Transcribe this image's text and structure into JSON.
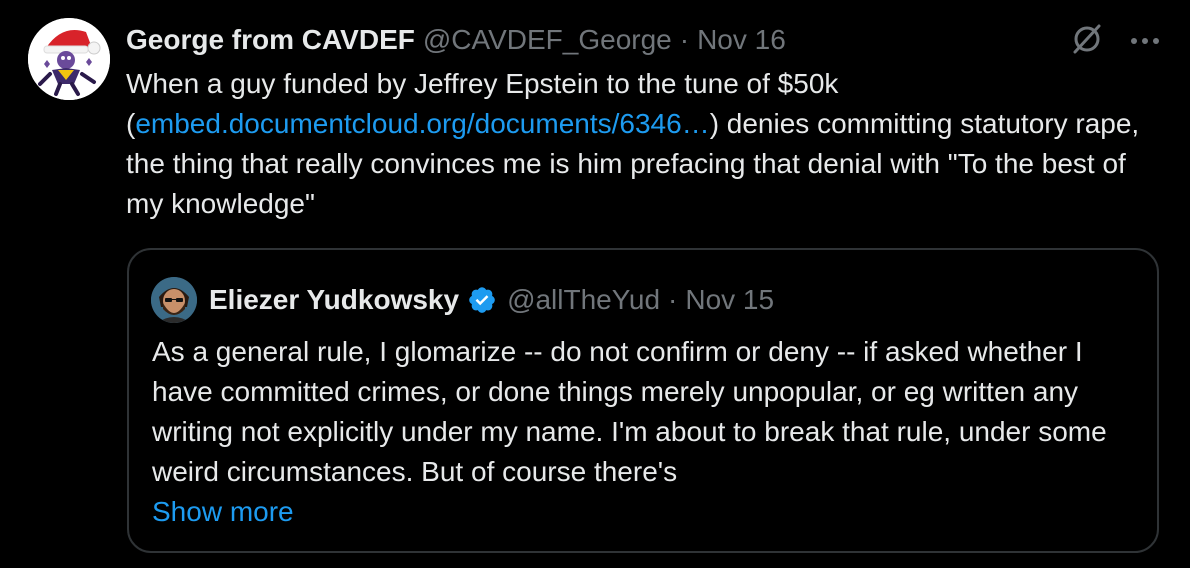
{
  "tweet": {
    "author": {
      "display_name": "George from CAVDEF",
      "handle": "@CAVDEF_George",
      "separator": "·",
      "date": "Nov 16"
    },
    "text": {
      "part1": "When a guy funded by Jeffrey Epstein to the tune of $50k (",
      "link": "embed.documentcloud.org/documents/6346…",
      "part2": ") denies committing statutory rape, the thing that really convinces me is him prefacing that denial with \"To the best of my knowledge\""
    },
    "icons": {
      "grok": "grok-icon",
      "more": "more-icon"
    }
  },
  "quote": {
    "author": {
      "display_name": "Eliezer Yudkowsky",
      "handle": "@allTheYud",
      "separator": "·",
      "date": "Nov 15"
    },
    "text": "As a general rule, I glomarize -- do not confirm or deny -- if asked whether I have committed crimes, or done things merely unpopular, or eg written any writing not explicitly under my name.  I'm about to break that rule, under some weird circumstances.  But of course there's",
    "show_more": "Show more"
  },
  "colors": {
    "background": "#000000",
    "text": "#e7e9ea",
    "muted": "#71767b",
    "link": "#1d9bf0",
    "border": "#2f3336"
  }
}
